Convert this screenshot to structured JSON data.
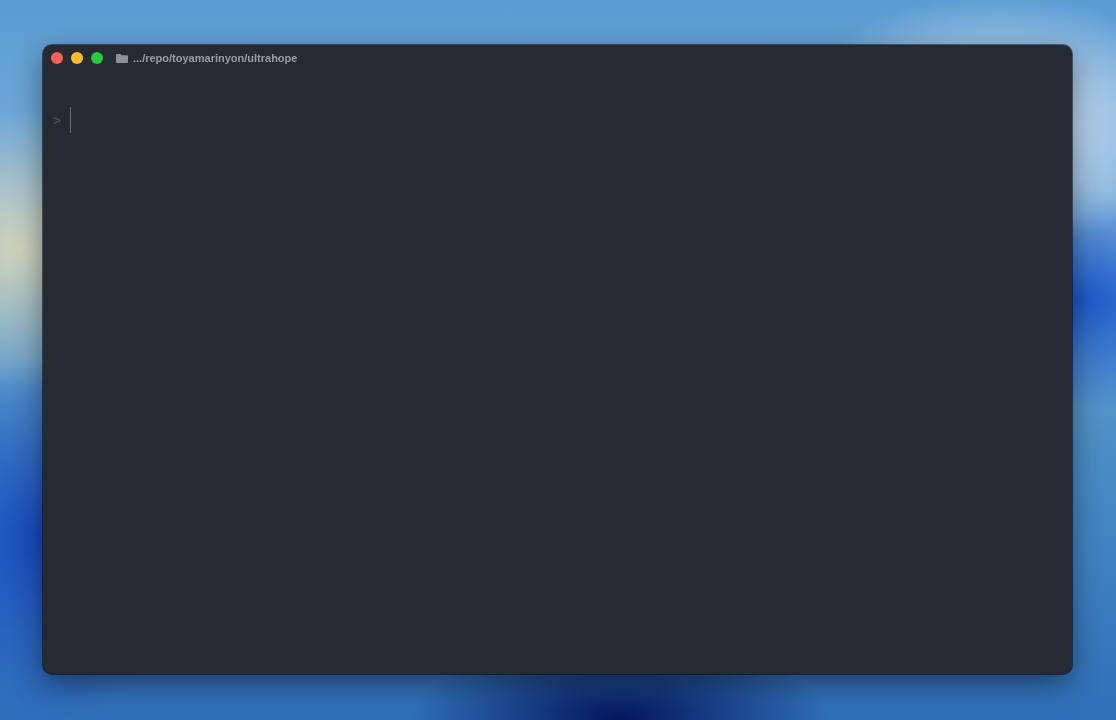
{
  "window": {
    "controls": [
      {
        "color": "#ff5f57"
      },
      {
        "color": "#febc2e"
      },
      {
        "color": "#28c840"
      }
    ],
    "title": ".../repo/toyamarinyon/ultrahope"
  },
  "terminal": {
    "prompt": ">"
  }
}
